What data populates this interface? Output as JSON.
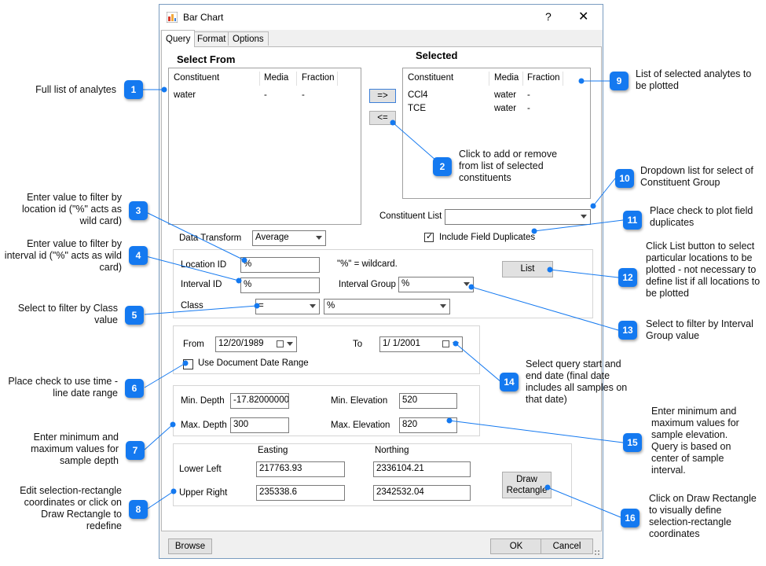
{
  "window": {
    "title": "Bar Chart",
    "help": "?",
    "close": "✕"
  },
  "tabs": [
    "Query",
    "Format",
    "Options"
  ],
  "select_from": {
    "heading": "Select From",
    "columns": [
      "Constituent",
      "Media",
      "Fraction"
    ],
    "rows": [
      {
        "constituent": "water",
        "media": "-",
        "fraction": "-"
      }
    ]
  },
  "selected": {
    "heading": "Selected",
    "columns": [
      "Constituent",
      "Media",
      "Fraction"
    ],
    "rows": [
      {
        "constituent": "CCl4",
        "media": "water",
        "fraction": "-"
      },
      {
        "constituent": "TCE",
        "media": "water",
        "fraction": "-"
      }
    ]
  },
  "move_buttons": {
    "add": "=>",
    "remove": "<="
  },
  "constituent_list": {
    "label": "Constituent List",
    "value": ""
  },
  "include_field_duplicates": {
    "label": "Include Field Duplicates",
    "checked": true
  },
  "data_transform": {
    "label": "Data Transform",
    "value": "Average"
  },
  "filters": {
    "location_id": {
      "label": "Location ID",
      "value": "%"
    },
    "wildcard_hint": "\"%\" = wildcard.",
    "list_button": "List",
    "interval_id": {
      "label": "Interval ID",
      "value": "%"
    },
    "interval_group": {
      "label": "Interval Group",
      "value": "%"
    },
    "class": {
      "label": "Class",
      "operator": "=",
      "value": "%"
    }
  },
  "dates": {
    "from_label": "From",
    "from_value": "12/20/1989",
    "to_label": "To",
    "to_value": "1/  1/2001",
    "use_document_range": {
      "label": "Use Document Date Range",
      "checked": false
    }
  },
  "depth_elevation": {
    "min_depth": {
      "label": "Min. Depth",
      "value": "-17.82000000"
    },
    "max_depth": {
      "label": "Max. Depth",
      "value": "300"
    },
    "min_elevation": {
      "label": "Min. Elevation",
      "value": "520"
    },
    "max_elevation": {
      "label": "Max. Elevation",
      "value": "820"
    }
  },
  "rectangle": {
    "easting_label": "Easting",
    "northing_label": "Northing",
    "lower_left": {
      "label": "Lower Left",
      "easting": "217763.93",
      "northing": "2336104.21"
    },
    "upper_right": {
      "label": "Upper Right",
      "easting": "235338.6",
      "northing": "2342532.04"
    },
    "draw_button_line1": "Draw",
    "draw_button_line2": "Rectangle"
  },
  "footer": {
    "browse": "Browse",
    "ok": "OK",
    "cancel": "Cancel"
  },
  "callouts": [
    {
      "num": "1",
      "text": "Full list of analytes"
    },
    {
      "num": "2",
      "text": "Click to add or remove from list of selected constituents"
    },
    {
      "num": "3",
      "text": "Enter value to filter by location id (\"%\" acts as wild card)"
    },
    {
      "num": "4",
      "text": "Enter value to filter by interval id (\"%\" acts as wild card)"
    },
    {
      "num": "5",
      "text": "Select to filter by Class value"
    },
    {
      "num": "6",
      "text": "Place check to use time -line date range"
    },
    {
      "num": "7",
      "text": "Enter minimum and maximum values for sample depth"
    },
    {
      "num": "8",
      "text": "Edit selection-rectangle coordinates or click on Draw Rectangle to redefine"
    },
    {
      "num": "9",
      "text": "List of selected analytes to be plotted"
    },
    {
      "num": "10",
      "text": "Dropdown list for select of Constituent Group"
    },
    {
      "num": "11",
      "text": "Place check to plot field duplicates"
    },
    {
      "num": "12",
      "text": "Click List button to select particular locations to be plotted - not necessary to define list if all locations to be plotted"
    },
    {
      "num": "13",
      "text": "Select to filter by Interval Group value"
    },
    {
      "num": "14",
      "text": "Select query start and end date (final date includes all samples on that date)"
    },
    {
      "num": "15",
      "text": "Enter minimum and maximum values for sample elevation. Query is based on center of sample interval."
    },
    {
      "num": "16",
      "text": "Click on Draw Rectangle to visually define selection-rectangle coordinates"
    }
  ]
}
